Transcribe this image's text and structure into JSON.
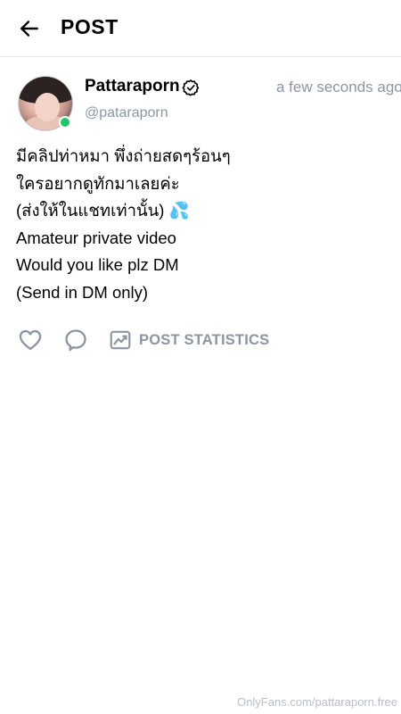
{
  "header": {
    "title": "POST"
  },
  "post": {
    "author": {
      "display_name": "Pattaraporn",
      "username": "@pataraporn",
      "online": true,
      "verified": true
    },
    "timestamp": "a few seconds ago",
    "text_lines": [
      "มีคลิปท่าหมา พึ่งถ่ายสดๆร้อนๆ",
      "ใครอยากดูทักมาเลยค่ะ",
      "(ส่งให้ในแชทเท่านั้น) 💦",
      "Amateur private video",
      "Would you like plz DM",
      "(Send in DM only)"
    ]
  },
  "actions": {
    "like_icon": "heart-icon",
    "comment_icon": "comment-icon",
    "stats_icon": "chart-icon",
    "stats_label": "POST STATISTICS"
  },
  "watermark": "OnlyFans.com/pattaraporn.free",
  "colors": {
    "muted": "#8a96a3",
    "online": "#1dc66a",
    "divider": "#e5e7eb"
  }
}
